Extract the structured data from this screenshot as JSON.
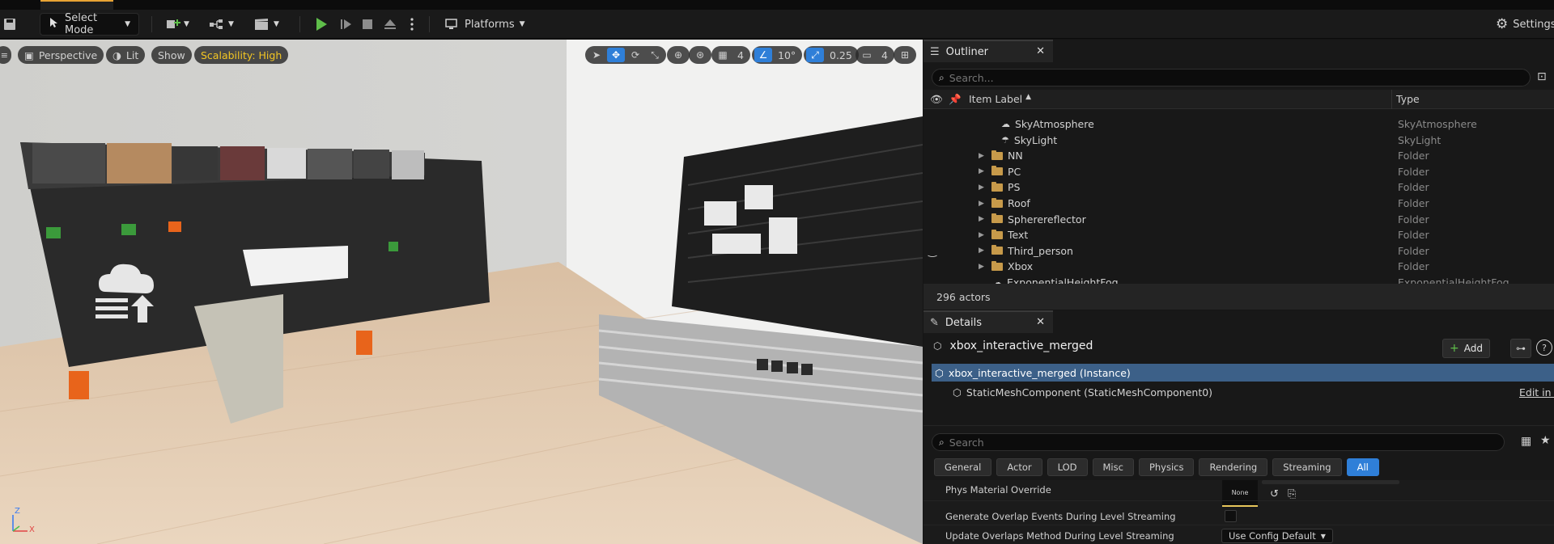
{
  "toolbar": {
    "select_mode": "Select Mode",
    "platforms": "Platforms",
    "settings": "Settings"
  },
  "viewport": {
    "perspective": "Perspective",
    "lit": "Lit",
    "show": "Show",
    "scalability": "Scalability: High",
    "grid_snap": "4",
    "rotation_snap": "10°",
    "scale_snap": "0.25",
    "camera_speed": "4",
    "axis_z": "Z",
    "axis_x": "X"
  },
  "outliner": {
    "tab_label": "Outliner",
    "search_placeholder": "Search...",
    "col_item_label": "Item Label",
    "col_type": "Type",
    "rows": [
      {
        "label": "SkyAtmosphere",
        "type": "SkyAtmosphere",
        "kind": "actor"
      },
      {
        "label": "SkyLight",
        "type": "SkyLight",
        "kind": "actor"
      },
      {
        "label": "NN",
        "type": "Folder",
        "kind": "folder"
      },
      {
        "label": "PC",
        "type": "Folder",
        "kind": "folder"
      },
      {
        "label": "PS",
        "type": "Folder",
        "kind": "folder"
      },
      {
        "label": "Roof",
        "type": "Folder",
        "kind": "folder"
      },
      {
        "label": "Spherereflector",
        "type": "Folder",
        "kind": "folder"
      },
      {
        "label": "Text",
        "type": "Folder",
        "kind": "folder"
      },
      {
        "label": "Third_person",
        "type": "Folder",
        "kind": "folder"
      },
      {
        "label": "Xbox",
        "type": "Folder",
        "kind": "folder"
      },
      {
        "label": "ExponentialHeightFog",
        "type": "ExponentialHeightFog",
        "kind": "actor"
      }
    ],
    "actor_count": "296 actors"
  },
  "details": {
    "tab_label": "Details",
    "object_name": "xbox_interactive_merged",
    "add_label": "Add",
    "instance_label": "xbox_interactive_merged (Instance)",
    "component_label": "StaticMeshComponent (StaticMeshComponent0)",
    "edit_link": "Edit in C",
    "search_placeholder": "Search",
    "filters": [
      "General",
      "Actor",
      "LOD",
      "Misc",
      "Physics",
      "Rendering",
      "Streaming",
      "All"
    ],
    "active_filter": "All",
    "props": {
      "phys_material": "Phys Material Override",
      "phys_material_value": "None",
      "overlap_events": "Generate Overlap Events During Level Streaming",
      "update_overlaps": "Update Overlaps Method During Level Streaming",
      "update_overlaps_value": "Use Config Default"
    }
  }
}
